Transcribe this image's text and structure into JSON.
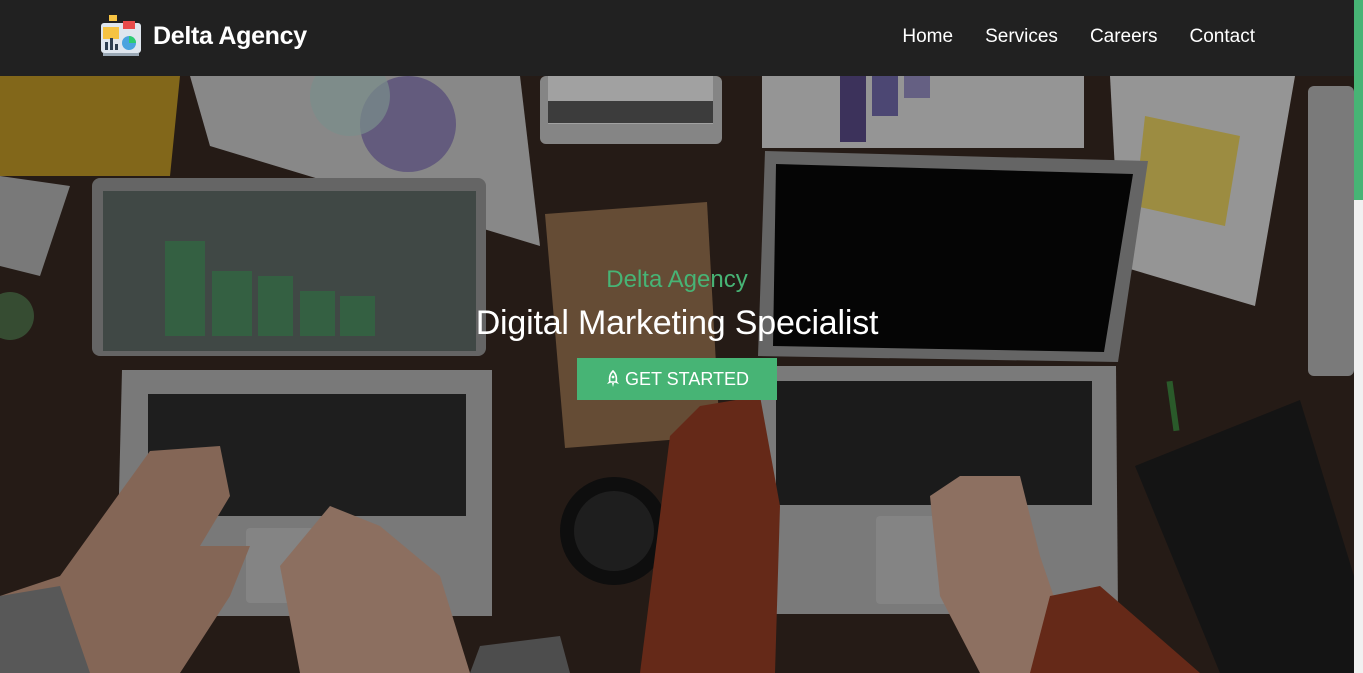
{
  "brand": {
    "name": "Delta Agency",
    "logo_icon": "agency-logo-icon"
  },
  "nav": {
    "items": [
      {
        "label": "Home"
      },
      {
        "label": "Services"
      },
      {
        "label": "Careers"
      },
      {
        "label": "Contact"
      }
    ]
  },
  "hero": {
    "subtitle": "Delta Agency",
    "title": "Digital Marketing Specialist",
    "cta_label": "GET STARTED",
    "cta_icon": "rocket-icon",
    "background": "laptops-on-desk-photo"
  },
  "colors": {
    "accent": "#47b475",
    "navbar": "#212121",
    "text": "#ffffff"
  }
}
